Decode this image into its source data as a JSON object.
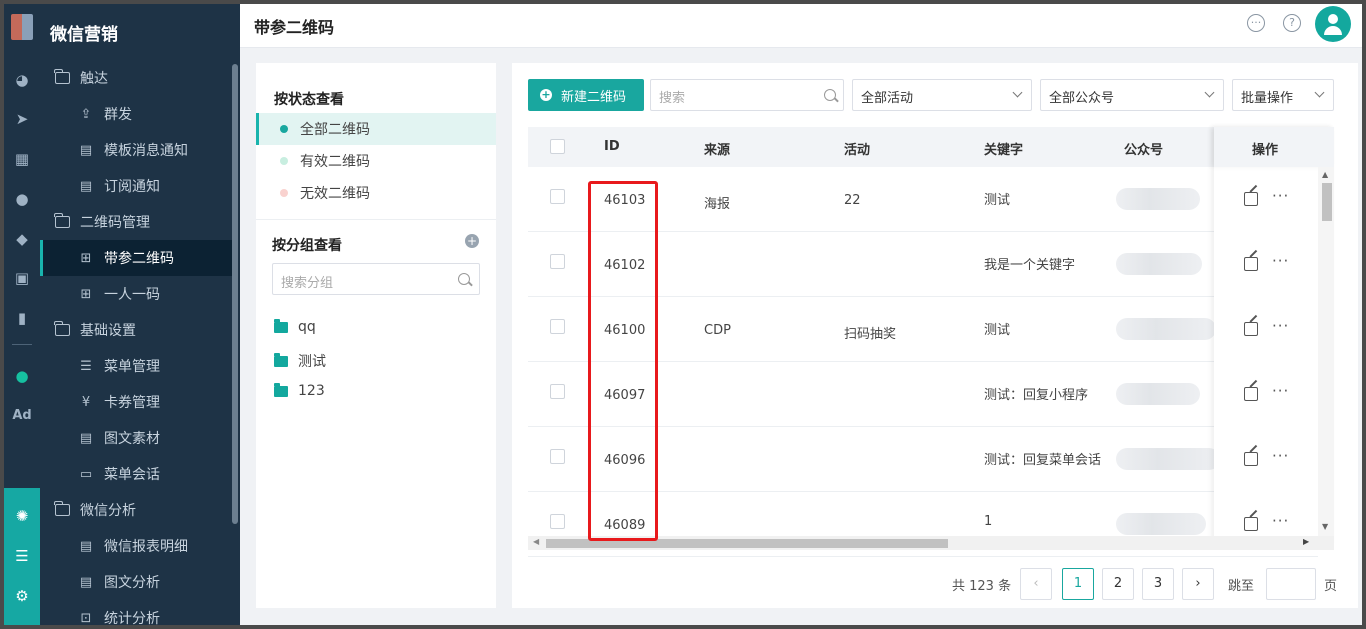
{
  "app": {
    "brand": "微信营销",
    "page_title": "带参二维码"
  },
  "rail": {
    "ad_label": "Ad"
  },
  "nav": [
    {
      "level": 1,
      "label": "触达",
      "icon": "folder-icon",
      "name": "nav-reach"
    },
    {
      "level": 2,
      "label": "群发",
      "icon": "broadcast-icon",
      "name": "nav-mass-send"
    },
    {
      "level": 2,
      "label": "模板消息通知",
      "icon": "template-icon",
      "name": "nav-template-msg"
    },
    {
      "level": 2,
      "label": "订阅通知",
      "icon": "subscribe-icon",
      "name": "nav-subscribe"
    },
    {
      "level": 1,
      "label": "二维码管理",
      "icon": "folder-icon",
      "name": "nav-qrcode-mgmt"
    },
    {
      "level": 2,
      "label": "带参二维码",
      "icon": "qrcode-icon",
      "name": "nav-param-qrcode",
      "active": true
    },
    {
      "level": 2,
      "label": "一人一码",
      "icon": "qrcode-icon",
      "name": "nav-one-person-code"
    },
    {
      "level": 1,
      "label": "基础设置",
      "icon": "folder-icon",
      "name": "nav-basic-settings"
    },
    {
      "level": 2,
      "label": "菜单管理",
      "icon": "menu-list-icon",
      "name": "nav-menu-mgmt"
    },
    {
      "level": 2,
      "label": "卡券管理",
      "icon": "coupon-icon",
      "name": "nav-coupon-mgmt"
    },
    {
      "level": 2,
      "label": "图文素材",
      "icon": "article-icon",
      "name": "nav-article-material"
    },
    {
      "level": 2,
      "label": "菜单会话",
      "icon": "chat-icon",
      "name": "nav-menu-session"
    },
    {
      "level": 1,
      "label": "微信分析",
      "icon": "folder-icon",
      "name": "nav-wechat-analysis"
    },
    {
      "level": 2,
      "label": "微信报表明细",
      "icon": "report-icon",
      "name": "nav-report-detail"
    },
    {
      "level": 2,
      "label": "图文分析",
      "icon": "article-icon",
      "name": "nav-article-analysis"
    },
    {
      "level": 2,
      "label": "统计分析",
      "icon": "stats-icon",
      "name": "nav-stats-analysis"
    }
  ],
  "filter_panel": {
    "status_title": "按状态查看",
    "statuses": [
      {
        "label": "全部二维码",
        "color": "#19a79f",
        "active": true
      },
      {
        "label": "有效二维码",
        "color": "#c8eee0"
      },
      {
        "label": "无效二维码",
        "color": "#f9d2cf"
      }
    ],
    "group_title": "按分组查看",
    "group_search_placeholder": "搜索分组",
    "groups": [
      "qq",
      "测试",
      "123"
    ]
  },
  "toolbar": {
    "new_button": "新建二维码",
    "search_placeholder": "搜索",
    "activity_select": "全部活动",
    "account_select": "全部公众号",
    "batch_button": "批量操作"
  },
  "table": {
    "columns": {
      "id": "ID",
      "source": "来源",
      "activity": "活动",
      "keyword": "关键字",
      "account": "公众号",
      "actions": "操作"
    },
    "rows": [
      {
        "id": "46103",
        "source": "海报",
        "activity": "22",
        "keyword": "测试"
      },
      {
        "id": "46102",
        "source": "",
        "activity": "",
        "keyword": "我是一个关键字"
      },
      {
        "id": "46100",
        "source": "CDP",
        "activity": "扫码抽奖",
        "keyword": "测试"
      },
      {
        "id": "46097",
        "source": "",
        "activity": "",
        "keyword": "测试：回复小程序"
      },
      {
        "id": "46096",
        "source": "",
        "activity": "",
        "keyword": "测试：回复菜单会话"
      },
      {
        "id": "46089",
        "source": "",
        "activity": "",
        "keyword": "1"
      }
    ]
  },
  "pagination": {
    "total_text": "共 123 条",
    "pages": [
      "1",
      "2",
      "3"
    ],
    "current_page": "1",
    "jump_label": "跳至",
    "page_suffix": "页"
  },
  "colors": {
    "accent": "#19a79f",
    "sidebar_bg": "#1e3346",
    "highlight_red": "#e8191c"
  }
}
